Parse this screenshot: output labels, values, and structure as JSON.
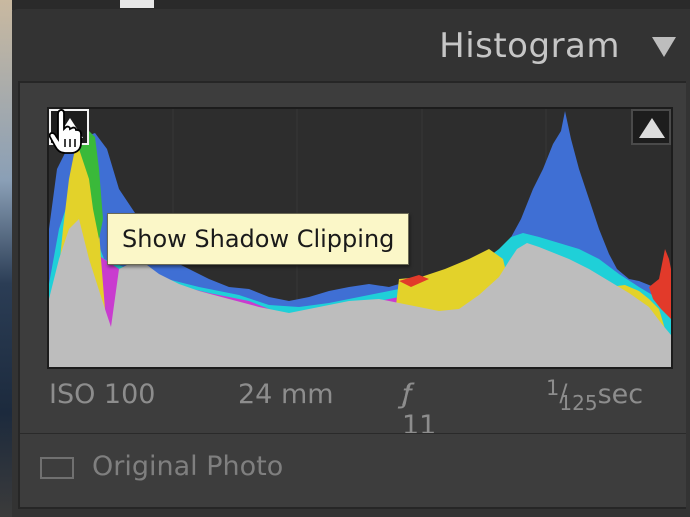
{
  "panel": {
    "title": "Histogram",
    "collapse_icon": "triangle-down-icon"
  },
  "histogram": {
    "shadow_clip_icon": "triangle-up-icon",
    "highlight_clip_icon": "triangle-up-icon",
    "cursor_icon": "pointing-hand-icon",
    "tooltip": "Show Shadow Clipping",
    "colors": {
      "luminance": "#bdbdbd",
      "blue": "#3f6fd4",
      "cyan": "#1fd0d8",
      "yellow": "#e3d22a",
      "red": "#e23a2a",
      "green": "#3ab93a",
      "magenta": "#c93ccf",
      "background": "#2d2d2d"
    }
  },
  "exif": {
    "iso": "ISO 100",
    "focal_length": "24 mm",
    "aperture_f": "ƒ",
    "aperture_rest": " / 11",
    "shutter_num": "1",
    "shutter_slash": "/",
    "shutter_den": "125",
    "shutter_unit": " sec"
  },
  "original_photo": {
    "label": "Original Photo",
    "checked": false
  }
}
